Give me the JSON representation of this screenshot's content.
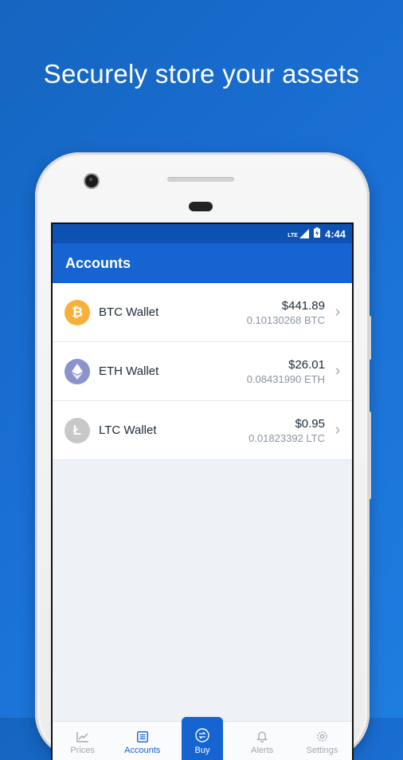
{
  "headline": "Securely store your assets",
  "status": {
    "network": "LTE",
    "time": "4:44"
  },
  "appbar": {
    "title": "Accounts"
  },
  "wallets": [
    {
      "name": "BTC Wallet",
      "fiat": "$441.89",
      "crypto": "0.10130268 BTC",
      "icon": "bitcoin-icon",
      "color": "#f7b13a",
      "glyph": "₿"
    },
    {
      "name": "ETH Wallet",
      "fiat": "$26.01",
      "crypto": "0.08431990 ETH",
      "icon": "ethereum-icon",
      "color": "#8a93cc",
      "glyph": "◆"
    },
    {
      "name": "LTC Wallet",
      "fiat": "$0.95",
      "crypto": "0.01823392 LTC",
      "icon": "litecoin-icon",
      "color": "#c8c8c8",
      "glyph": "Ł"
    }
  ],
  "tabs": [
    {
      "label": "Prices",
      "icon": "chart-icon"
    },
    {
      "label": "Accounts",
      "icon": "list-icon"
    },
    {
      "label": "Buy",
      "icon": "exchange-icon"
    },
    {
      "label": "Alerts",
      "icon": "bell-icon"
    },
    {
      "label": "Settings",
      "icon": "gear-icon"
    }
  ],
  "colors": {
    "primary": "#1564d2",
    "statusbar": "#0d52b3"
  }
}
